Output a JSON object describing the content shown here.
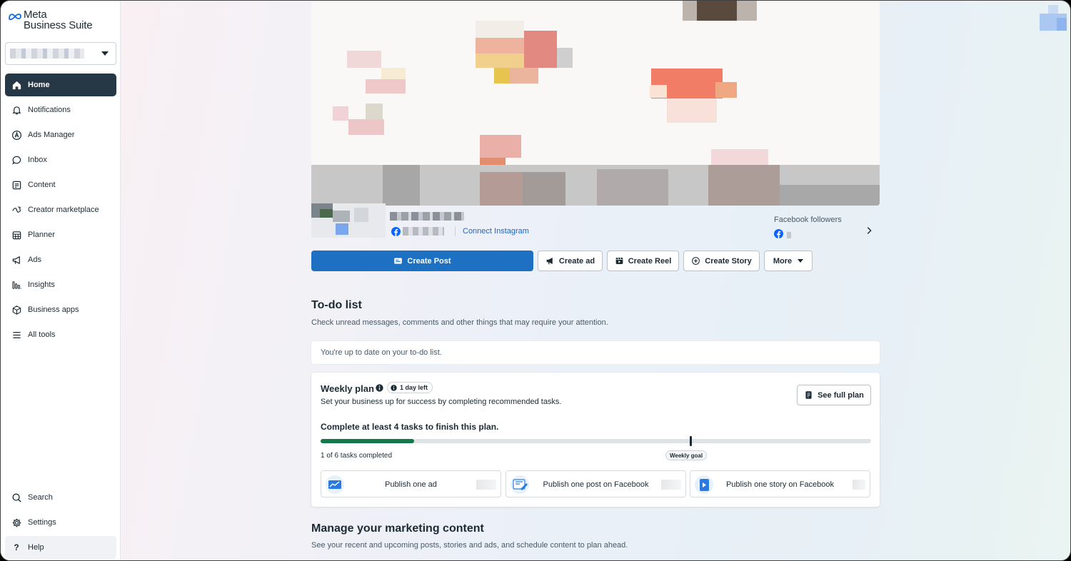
{
  "app": {
    "brand_line1": "Meta",
    "brand_line2": "Business Suite"
  },
  "sidebar": {
    "items": [
      {
        "label": "Home",
        "icon": "home-icon"
      },
      {
        "label": "Notifications",
        "icon": "bell-icon"
      },
      {
        "label": "Ads Manager",
        "icon": "ads-manager-icon"
      },
      {
        "label": "Inbox",
        "icon": "chat-bubble-icon"
      },
      {
        "label": "Content",
        "icon": "content-icon"
      },
      {
        "label": "Creator marketplace",
        "icon": "creator-icon"
      },
      {
        "label": "Planner",
        "icon": "calendar-icon"
      },
      {
        "label": "Ads",
        "icon": "megaphone-icon"
      },
      {
        "label": "Insights",
        "icon": "bar-chart-icon"
      },
      {
        "label": "Business apps",
        "icon": "cube-icon"
      },
      {
        "label": "All tools",
        "icon": "menu-icon"
      }
    ],
    "bottom_items": [
      {
        "label": "Search",
        "icon": "search-icon"
      },
      {
        "label": "Settings",
        "icon": "gear-icon"
      },
      {
        "label": "Help",
        "icon": "question-icon"
      }
    ]
  },
  "profile": {
    "connect_instagram": "Connect Instagram",
    "followers_label": "Facebook followers"
  },
  "actions": {
    "create_post": "Create Post",
    "create_ad": "Create ad",
    "create_reel": "Create Reel",
    "create_story": "Create Story",
    "more": "More"
  },
  "todo": {
    "title": "To-do list",
    "subtitle": "Check unread messages, comments and other things that may require your attention.",
    "status": "You're up to date on your to-do list."
  },
  "weekly_plan": {
    "title": "Weekly plan",
    "days_left": "1 day left",
    "description": "Set your business up for success by completing recommended tasks.",
    "see_full_plan": "See full plan",
    "goal_text": "Complete at least 4 tasks to finish this plan.",
    "progress_fraction": 0.17,
    "weekly_goal_fraction": 0.67,
    "tasks_completed": "1 of 6 tasks completed",
    "weekly_goal_label": "Weekly goal",
    "tasks": [
      {
        "label": "Publish one ad"
      },
      {
        "label": "Publish one post on Facebook"
      },
      {
        "label": "Publish one story on Facebook"
      }
    ]
  },
  "marketing": {
    "title": "Manage your marketing content",
    "subtitle": "See your recent and upcoming posts, stories and ads, and schedule content to plan ahead."
  },
  "colors": {
    "primary": "#1d70c2",
    "nav_active": "#263845",
    "progress": "#13794c",
    "link": "#1d65c1"
  }
}
